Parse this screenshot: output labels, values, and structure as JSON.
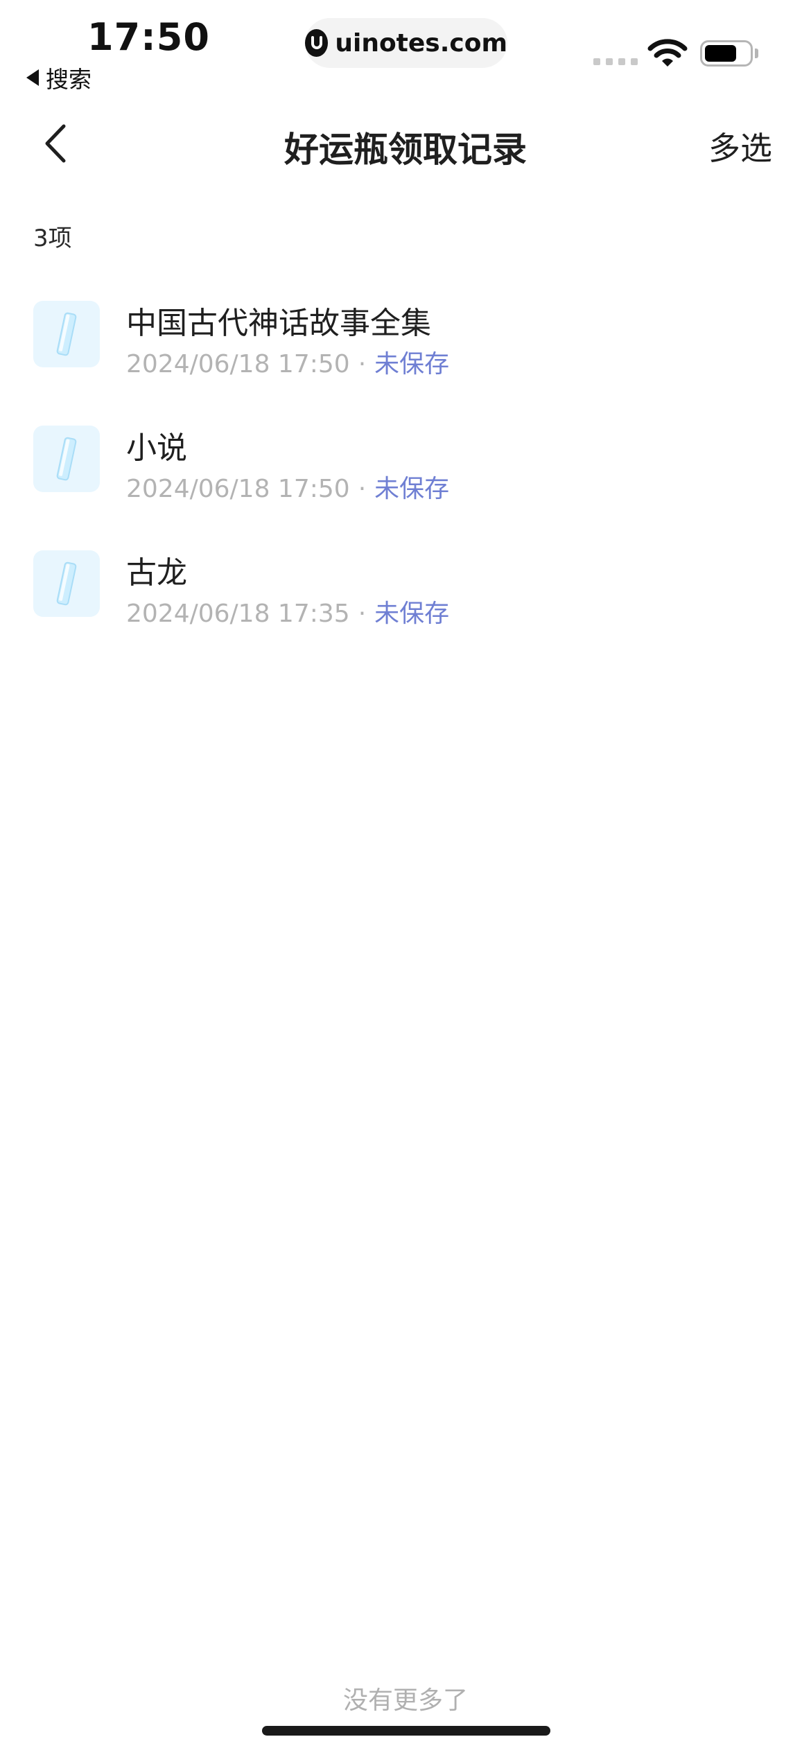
{
  "status_bar": {
    "time": "17:50",
    "back_app_label": "搜索",
    "url": "uinotes.com",
    "battery_level": 0.7
  },
  "nav": {
    "title": "好运瓶领取记录",
    "action_label": "多选"
  },
  "list": {
    "count_label": "3项",
    "items": [
      {
        "title": "中国古代神话故事全集",
        "timestamp": "2024/06/18 17:50",
        "separator": "·",
        "status": "未保存"
      },
      {
        "title": "小说",
        "timestamp": "2024/06/18 17:50",
        "separator": "·",
        "status": "未保存"
      },
      {
        "title": "古龙",
        "timestamp": "2024/06/18 17:35",
        "separator": "·",
        "status": "未保存"
      }
    ]
  },
  "footer": {
    "no_more_label": "没有更多了"
  },
  "colors": {
    "status_accent": "#6f7fd3",
    "thumb_bg": "#e8f6fe"
  }
}
